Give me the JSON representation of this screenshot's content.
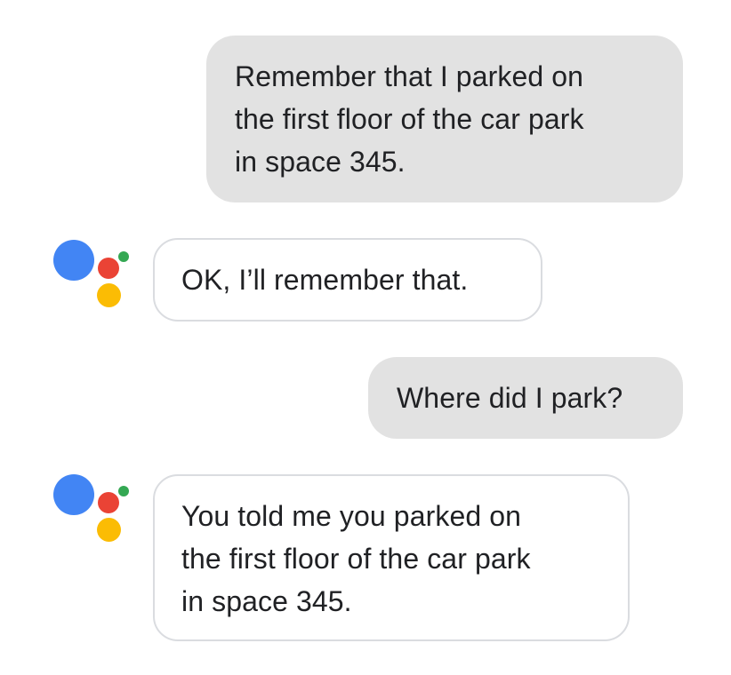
{
  "conversation": {
    "messages": [
      {
        "role": "user",
        "lines": [
          "Remember that I parked on",
          "the first floor of the car park",
          "in space 345."
        ]
      },
      {
        "role": "assistant",
        "lines": [
          "OK, I’ll remember that."
        ]
      },
      {
        "role": "user",
        "lines": [
          "Where did I park?"
        ]
      },
      {
        "role": "assistant",
        "lines": [
          "You told me you parked on",
          "the first floor of the car park",
          "in space 345."
        ]
      }
    ]
  },
  "assistant_logo": {
    "icon": "google-assistant-icon",
    "colors": {
      "blue": "#4285f4",
      "red": "#ea4335",
      "yellow": "#fbbc04",
      "green": "#34a853"
    }
  },
  "colors": {
    "user_bubble": "#e2e2e2",
    "assistant_bubble_border": "#dadce0",
    "text": "#202124"
  }
}
